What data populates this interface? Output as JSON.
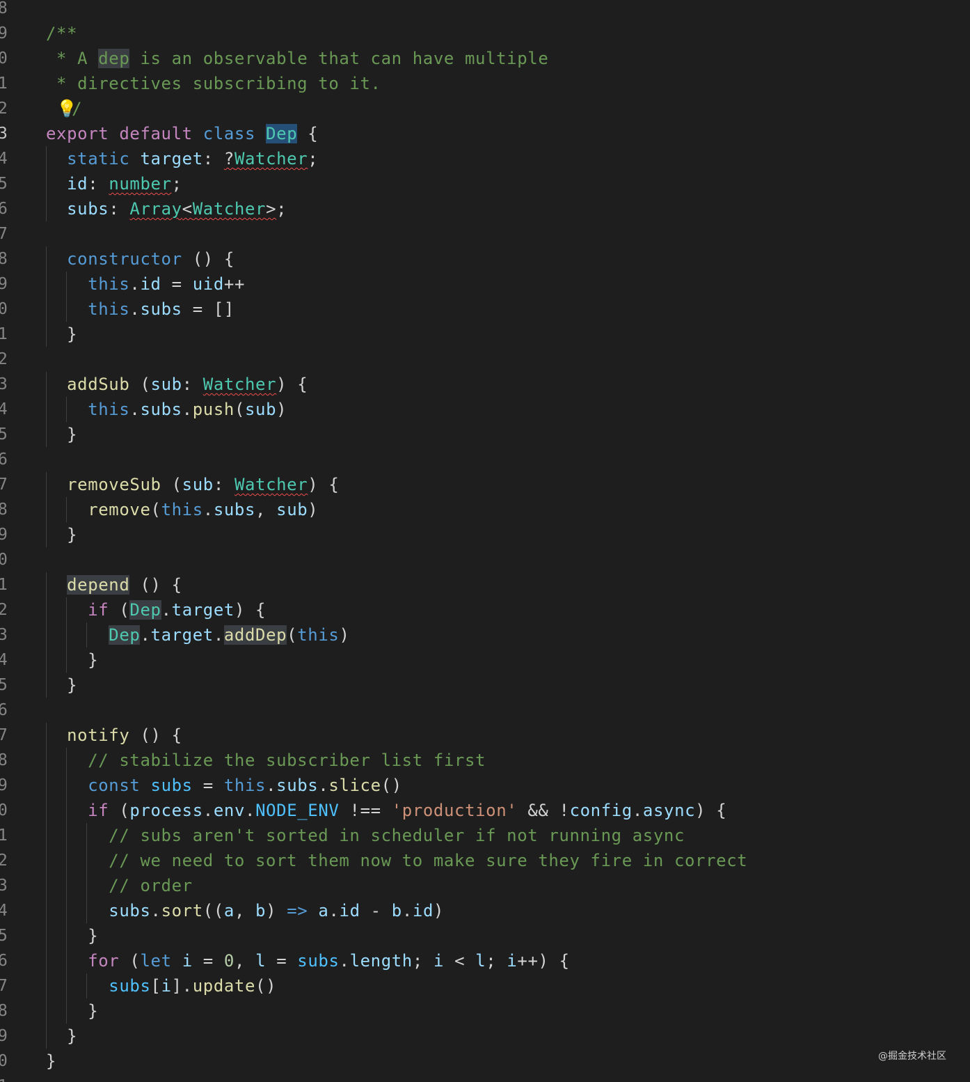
{
  "editor": {
    "theme_colors": {
      "background": "#1e1e1e",
      "comment": "#6a9955",
      "keyword": "#569cd6",
      "control": "#c586c0",
      "type": "#4ec9b0",
      "function": "#dcdcaa",
      "variable": "#9cdcfe",
      "string": "#ce9178",
      "number": "#b5cea8",
      "error_squiggle": "#f14c4c"
    },
    "gutter_numbers": [
      "8",
      "9",
      "0",
      "1",
      "2",
      "3",
      "4",
      "5",
      "6",
      "7",
      "8",
      "9",
      "0",
      "1",
      "2",
      "3",
      "4",
      "5",
      "6",
      "7",
      "8",
      "9",
      "0",
      "1",
      "2",
      "3",
      "4",
      "5",
      "6",
      "7",
      "8",
      "9",
      "0",
      "1",
      "2",
      "3",
      "4",
      "5",
      "6",
      "7",
      "8",
      "9",
      "0",
      "1"
    ],
    "active_line_number": "3",
    "lightbulb_icon": "lightbulb-icon",
    "lines": [
      [],
      [
        {
          "t": "/**",
          "c": "cm"
        }
      ],
      [
        {
          "t": " * A ",
          "c": "cm"
        },
        {
          "t": "dep",
          "c": "cm hl"
        },
        {
          "t": " is an observable that can have multiple",
          "c": "cm"
        }
      ],
      [
        {
          "t": " * directives subscribing to it.",
          "c": "cm"
        }
      ],
      [
        {
          "t": " ",
          "c": "pl"
        },
        {
          "t": "💡",
          "c": "bulb"
        },
        {
          "t": "/",
          "c": "cm"
        }
      ],
      [
        {
          "t": "export",
          "c": "kc"
        },
        {
          "t": " ",
          "c": "pl"
        },
        {
          "t": "default",
          "c": "kc"
        },
        {
          "t": " ",
          "c": "pl"
        },
        {
          "t": "class",
          "c": "kw"
        },
        {
          "t": " ",
          "c": "pl"
        },
        {
          "t": "Dep",
          "c": "ty hlsel"
        },
        {
          "t": " {",
          "c": "pl"
        }
      ],
      [
        {
          "t": "  ",
          "c": "pl"
        },
        {
          "t": "static",
          "c": "kw"
        },
        {
          "t": " ",
          "c": "pl"
        },
        {
          "t": "target",
          "c": "vr"
        },
        {
          "t": ": ",
          "c": "pl"
        },
        {
          "t": "?",
          "c": "pl sq"
        },
        {
          "t": "Watcher",
          "c": "ty sq"
        },
        {
          "t": ";",
          "c": "pl"
        }
      ],
      [
        {
          "t": "  ",
          "c": "pl"
        },
        {
          "t": "id",
          "c": "vr"
        },
        {
          "t": ": ",
          "c": "pl"
        },
        {
          "t": "number",
          "c": "ty sq"
        },
        {
          "t": ";",
          "c": "pl"
        }
      ],
      [
        {
          "t": "  ",
          "c": "pl"
        },
        {
          "t": "subs",
          "c": "vr"
        },
        {
          "t": ": ",
          "c": "pl"
        },
        {
          "t": "Array",
          "c": "ty sq"
        },
        {
          "t": "<",
          "c": "pl sq"
        },
        {
          "t": "Watcher",
          "c": "ty sq"
        },
        {
          "t": ">",
          "c": "pl sq"
        },
        {
          "t": ";",
          "c": "pl"
        }
      ],
      [],
      [
        {
          "t": "  ",
          "c": "pl"
        },
        {
          "t": "constructor",
          "c": "kw"
        },
        {
          "t": " () {",
          "c": "pl"
        }
      ],
      [
        {
          "t": "    ",
          "c": "pl"
        },
        {
          "t": "this",
          "c": "kw"
        },
        {
          "t": ".",
          "c": "pl"
        },
        {
          "t": "id",
          "c": "vr"
        },
        {
          "t": " = ",
          "c": "pl"
        },
        {
          "t": "uid",
          "c": "vr"
        },
        {
          "t": "++",
          "c": "pl"
        }
      ],
      [
        {
          "t": "    ",
          "c": "pl"
        },
        {
          "t": "this",
          "c": "kw"
        },
        {
          "t": ".",
          "c": "pl"
        },
        {
          "t": "subs",
          "c": "vr"
        },
        {
          "t": " = []",
          "c": "pl"
        }
      ],
      [
        {
          "t": "  }",
          "c": "pl"
        }
      ],
      [],
      [
        {
          "t": "  ",
          "c": "pl"
        },
        {
          "t": "addSub",
          "c": "fn"
        },
        {
          "t": " (",
          "c": "pl"
        },
        {
          "t": "sub",
          "c": "vr"
        },
        {
          "t": ": ",
          "c": "pl"
        },
        {
          "t": "Watcher",
          "c": "ty sq"
        },
        {
          "t": ") {",
          "c": "pl"
        }
      ],
      [
        {
          "t": "    ",
          "c": "pl"
        },
        {
          "t": "this",
          "c": "kw"
        },
        {
          "t": ".",
          "c": "pl"
        },
        {
          "t": "subs",
          "c": "vr"
        },
        {
          "t": ".",
          "c": "pl"
        },
        {
          "t": "push",
          "c": "fn"
        },
        {
          "t": "(",
          "c": "pl"
        },
        {
          "t": "sub",
          "c": "vr"
        },
        {
          "t": ")",
          "c": "pl"
        }
      ],
      [
        {
          "t": "  }",
          "c": "pl"
        }
      ],
      [],
      [
        {
          "t": "  ",
          "c": "pl"
        },
        {
          "t": "removeSub",
          "c": "fn"
        },
        {
          "t": " (",
          "c": "pl"
        },
        {
          "t": "sub",
          "c": "vr"
        },
        {
          "t": ": ",
          "c": "pl"
        },
        {
          "t": "Watcher",
          "c": "ty sq"
        },
        {
          "t": ") {",
          "c": "pl"
        }
      ],
      [
        {
          "t": "    ",
          "c": "pl"
        },
        {
          "t": "remove",
          "c": "fn"
        },
        {
          "t": "(",
          "c": "pl"
        },
        {
          "t": "this",
          "c": "kw"
        },
        {
          "t": ".",
          "c": "pl"
        },
        {
          "t": "subs",
          "c": "vr"
        },
        {
          "t": ", ",
          "c": "pl"
        },
        {
          "t": "sub",
          "c": "vr"
        },
        {
          "t": ")",
          "c": "pl"
        }
      ],
      [
        {
          "t": "  }",
          "c": "pl"
        }
      ],
      [],
      [
        {
          "t": "  ",
          "c": "pl"
        },
        {
          "t": "depend",
          "c": "fn hl"
        },
        {
          "t": " () {",
          "c": "pl"
        }
      ],
      [
        {
          "t": "    ",
          "c": "pl"
        },
        {
          "t": "if",
          "c": "kc"
        },
        {
          "t": " (",
          "c": "pl"
        },
        {
          "t": "Dep",
          "c": "ty hl"
        },
        {
          "t": ".",
          "c": "pl"
        },
        {
          "t": "target",
          "c": "vr"
        },
        {
          "t": ") {",
          "c": "pl"
        }
      ],
      [
        {
          "t": "      ",
          "c": "pl"
        },
        {
          "t": "Dep",
          "c": "ty hl"
        },
        {
          "t": ".",
          "c": "pl"
        },
        {
          "t": "target",
          "c": "vr"
        },
        {
          "t": ".",
          "c": "pl"
        },
        {
          "t": "addDep",
          "c": "fn hl"
        },
        {
          "t": "(",
          "c": "pl"
        },
        {
          "t": "this",
          "c": "kw"
        },
        {
          "t": ")",
          "c": "pl"
        }
      ],
      [
        {
          "t": "    }",
          "c": "pl"
        }
      ],
      [
        {
          "t": "  }",
          "c": "pl"
        }
      ],
      [],
      [
        {
          "t": "  ",
          "c": "pl"
        },
        {
          "t": "notify",
          "c": "fn"
        },
        {
          "t": " () {",
          "c": "pl"
        }
      ],
      [
        {
          "t": "    ",
          "c": "pl"
        },
        {
          "t": "// stabilize the subscriber list first",
          "c": "cm"
        }
      ],
      [
        {
          "t": "    ",
          "c": "pl"
        },
        {
          "t": "const",
          "c": "kw"
        },
        {
          "t": " ",
          "c": "pl"
        },
        {
          "t": "subs",
          "c": "cn"
        },
        {
          "t": " = ",
          "c": "pl"
        },
        {
          "t": "this",
          "c": "kw"
        },
        {
          "t": ".",
          "c": "pl"
        },
        {
          "t": "subs",
          "c": "vr"
        },
        {
          "t": ".",
          "c": "pl"
        },
        {
          "t": "slice",
          "c": "fn"
        },
        {
          "t": "()",
          "c": "pl"
        }
      ],
      [
        {
          "t": "    ",
          "c": "pl"
        },
        {
          "t": "if",
          "c": "kc"
        },
        {
          "t": " (",
          "c": "pl"
        },
        {
          "t": "process",
          "c": "vr"
        },
        {
          "t": ".",
          "c": "pl"
        },
        {
          "t": "env",
          "c": "vr"
        },
        {
          "t": ".",
          "c": "pl"
        },
        {
          "t": "NODE_ENV",
          "c": "cn"
        },
        {
          "t": " !== ",
          "c": "pl"
        },
        {
          "t": "'production'",
          "c": "st"
        },
        {
          "t": " && !",
          "c": "pl"
        },
        {
          "t": "config",
          "c": "vr"
        },
        {
          "t": ".",
          "c": "pl"
        },
        {
          "t": "async",
          "c": "vr"
        },
        {
          "t": ") {",
          "c": "pl"
        }
      ],
      [
        {
          "t": "      ",
          "c": "pl"
        },
        {
          "t": "// subs aren't sorted in scheduler if not running async",
          "c": "cm"
        }
      ],
      [
        {
          "t": "      ",
          "c": "pl"
        },
        {
          "t": "// we need to sort them now to make sure they fire in correct",
          "c": "cm"
        }
      ],
      [
        {
          "t": "      ",
          "c": "pl"
        },
        {
          "t": "// order",
          "c": "cm"
        }
      ],
      [
        {
          "t": "      ",
          "c": "pl"
        },
        {
          "t": "subs",
          "c": "vr"
        },
        {
          "t": ".",
          "c": "pl"
        },
        {
          "t": "sort",
          "c": "fn"
        },
        {
          "t": "((",
          "c": "pl"
        },
        {
          "t": "a",
          "c": "vr"
        },
        {
          "t": ", ",
          "c": "pl"
        },
        {
          "t": "b",
          "c": "vr"
        },
        {
          "t": ") ",
          "c": "pl"
        },
        {
          "t": "=>",
          "c": "kw"
        },
        {
          "t": " ",
          "c": "pl"
        },
        {
          "t": "a",
          "c": "vr"
        },
        {
          "t": ".",
          "c": "pl"
        },
        {
          "t": "id",
          "c": "vr"
        },
        {
          "t": " - ",
          "c": "pl"
        },
        {
          "t": "b",
          "c": "vr"
        },
        {
          "t": ".",
          "c": "pl"
        },
        {
          "t": "id",
          "c": "vr"
        },
        {
          "t": ")",
          "c": "pl"
        }
      ],
      [
        {
          "t": "    }",
          "c": "pl"
        }
      ],
      [
        {
          "t": "    ",
          "c": "pl"
        },
        {
          "t": "for",
          "c": "kc"
        },
        {
          "t": " (",
          "c": "pl"
        },
        {
          "t": "let",
          "c": "kw"
        },
        {
          "t": " ",
          "c": "pl"
        },
        {
          "t": "i",
          "c": "vr"
        },
        {
          "t": " = ",
          "c": "pl"
        },
        {
          "t": "0",
          "c": "nm"
        },
        {
          "t": ", ",
          "c": "pl"
        },
        {
          "t": "l",
          "c": "vr"
        },
        {
          "t": " = ",
          "c": "pl"
        },
        {
          "t": "subs",
          "c": "cn"
        },
        {
          "t": ".",
          "c": "pl"
        },
        {
          "t": "length",
          "c": "vr"
        },
        {
          "t": "; ",
          "c": "pl"
        },
        {
          "t": "i",
          "c": "vr"
        },
        {
          "t": " < ",
          "c": "pl"
        },
        {
          "t": "l",
          "c": "vr"
        },
        {
          "t": "; ",
          "c": "pl"
        },
        {
          "t": "i",
          "c": "vr"
        },
        {
          "t": "++) {",
          "c": "pl"
        }
      ],
      [
        {
          "t": "      ",
          "c": "pl"
        },
        {
          "t": "subs",
          "c": "cn"
        },
        {
          "t": "[",
          "c": "pl"
        },
        {
          "t": "i",
          "c": "vr"
        },
        {
          "t": "].",
          "c": "pl"
        },
        {
          "t": "update",
          "c": "fn"
        },
        {
          "t": "()",
          "c": "pl"
        }
      ],
      [
        {
          "t": "    }",
          "c": "pl"
        }
      ],
      [
        {
          "t": "  }",
          "c": "pl"
        }
      ],
      [
        {
          "t": "}",
          "c": "pl"
        }
      ],
      []
    ]
  },
  "watermark": "@掘金技术社区"
}
